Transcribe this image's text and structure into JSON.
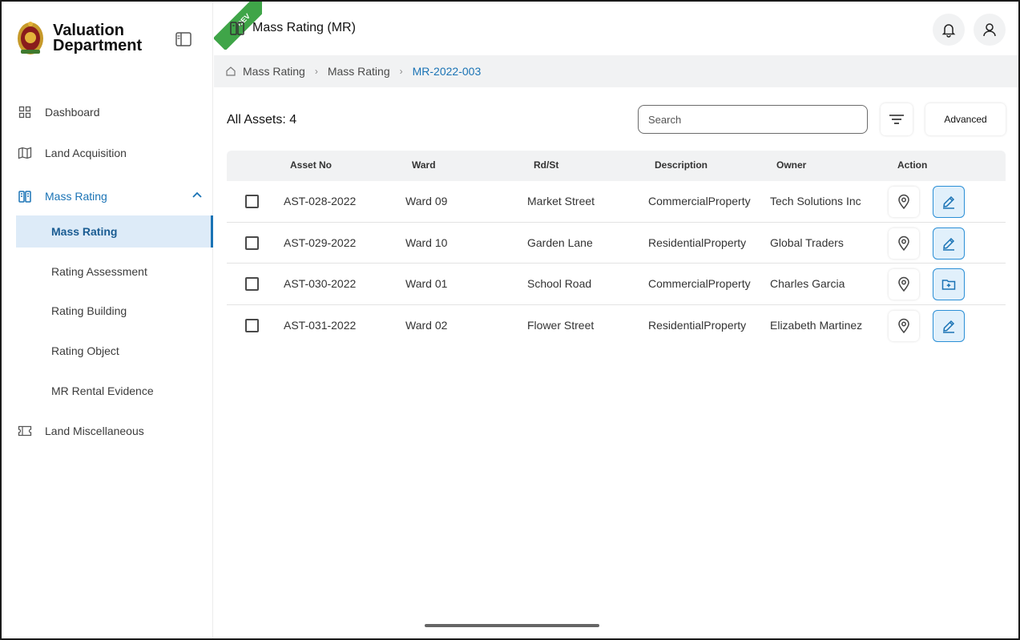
{
  "brand": {
    "line1": "Valuation",
    "line2": "Department"
  },
  "sidebar": {
    "items": [
      {
        "label": "Dashboard",
        "icon": "grid-icon"
      },
      {
        "label": "Land Acquisition",
        "icon": "map-icon"
      },
      {
        "label": "Mass Rating",
        "icon": "buildings-icon",
        "expanded": true
      },
      {
        "label": "Land Miscellaneous",
        "icon": "ticket-icon"
      }
    ],
    "sub_items": [
      {
        "label": "Mass Rating",
        "selected": true
      },
      {
        "label": "Rating Assessment"
      },
      {
        "label": "Rating Building"
      },
      {
        "label": "Rating Object"
      },
      {
        "label": "MR Rental Evidence"
      }
    ]
  },
  "header": {
    "title": "Mass Rating (MR)",
    "env_badge": "DEV"
  },
  "breadcrumb": {
    "items": [
      "Mass Rating",
      "Mass Rating"
    ],
    "current": "MR-2022-003"
  },
  "toolbar": {
    "count_label": "All Assets: 4",
    "search_placeholder": "Search",
    "advanced_label": "Advanced"
  },
  "table": {
    "columns": [
      "Asset No",
      "Ward",
      "Rd/St",
      "Description",
      "Owner",
      "Action"
    ],
    "rows": [
      {
        "asset_no": "AST-028-2022",
        "ward": "Ward 09",
        "street": "Market Street",
        "description": "CommercialProperty",
        "owner": "Tech Solutions Inc",
        "action_icon": "edit-icon"
      },
      {
        "asset_no": "AST-029-2022",
        "ward": "Ward 10",
        "street": "Garden Lane",
        "description": "ResidentialProperty",
        "owner": "Global Traders",
        "action_icon": "edit-icon"
      },
      {
        "asset_no": "AST-030-2022",
        "ward": "Ward 01",
        "street": "School Road",
        "description": "CommercialProperty",
        "owner": "Charles Garcia",
        "action_icon": "folder-add-icon"
      },
      {
        "asset_no": "AST-031-2022",
        "ward": "Ward 02",
        "street": "Flower Street",
        "description": "ResidentialProperty",
        "owner": "Elizabeth Martinez",
        "action_icon": "edit-icon"
      }
    ]
  },
  "colors": {
    "accent": "#1a73b5",
    "selected_bg": "#ddebf8",
    "dev_badge": "#3fa548"
  }
}
